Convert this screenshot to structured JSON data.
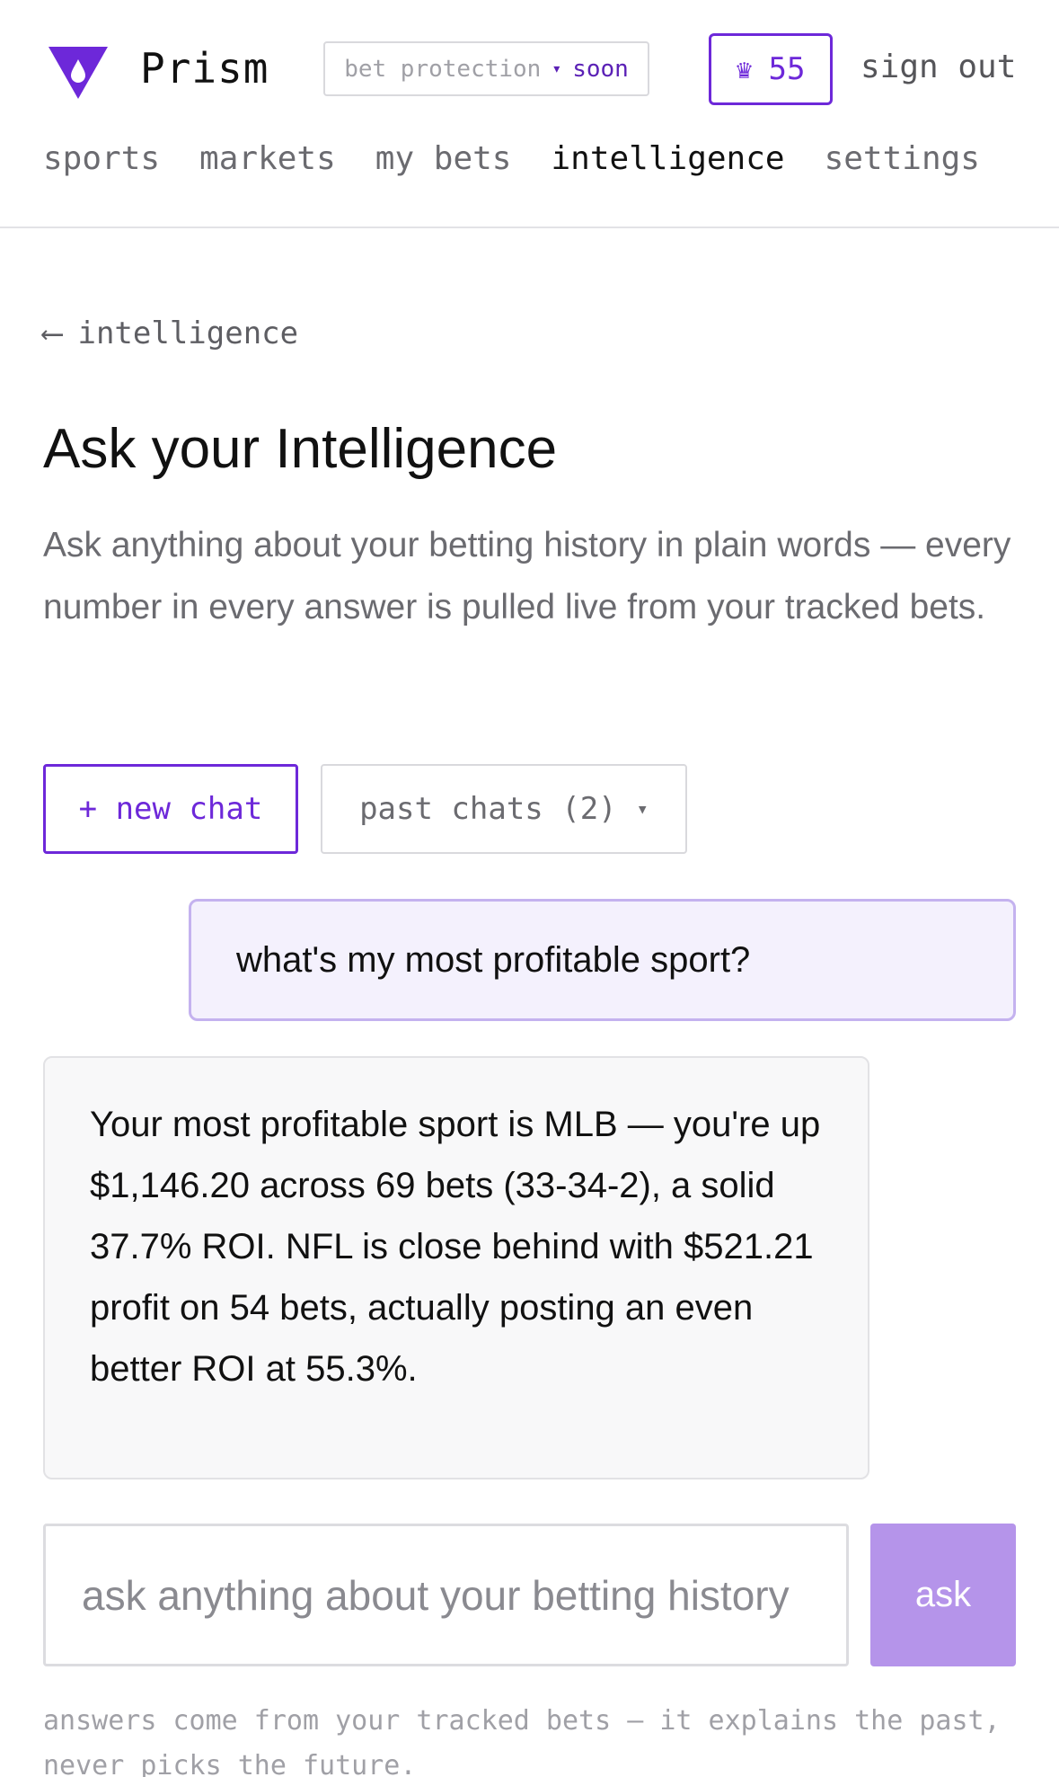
{
  "header": {
    "brand": "Prism",
    "logo_icon": "prism-drop-logo",
    "badge": {
      "label": "bet protection",
      "caret": "▾",
      "status": "soon"
    },
    "credits": {
      "icon": "crown-icon",
      "symbol": "♛",
      "value": "55"
    },
    "sign_out": "sign out",
    "nav": [
      {
        "label": "sports",
        "active": false
      },
      {
        "label": "markets",
        "active": false
      },
      {
        "label": "my bets",
        "active": false
      },
      {
        "label": "intelligence",
        "active": true
      },
      {
        "label": "settings",
        "active": false
      }
    ]
  },
  "main": {
    "back": {
      "arrow": "⟵",
      "label": "intelligence"
    },
    "title": "Ask your Intelligence",
    "subtitle": "Ask anything about your betting history in plain words — every number in every answer is pulled live from your tracked bets.",
    "actions": {
      "new_chat": "+ new chat",
      "past_chats": "past chats (2)",
      "past_chats_caret": "▾"
    },
    "conversation": [
      {
        "role": "user",
        "text": "what's my most profitable sport?"
      },
      {
        "role": "assistant",
        "text": "Your most profitable sport is MLB — you're up $1,146.20 across 69 bets (33-34-2), a solid 37.7% ROI. NFL is close behind with $521.21 profit on 54 bets, actually posting an even better ROI at 55.3%."
      }
    ],
    "input": {
      "placeholder": "ask anything about your betting history",
      "value": ""
    },
    "ask_label": "ask",
    "footnote": "answers come from your tracked bets — it explains the past, never picks the future."
  },
  "colors": {
    "accent": "#6d28d9",
    "accent_light": "#b594ea",
    "user_bubble_bg": "#f4f1fd",
    "user_bubble_border": "#c4b2ef",
    "assistant_bubble_bg": "#f8f8f9"
  }
}
